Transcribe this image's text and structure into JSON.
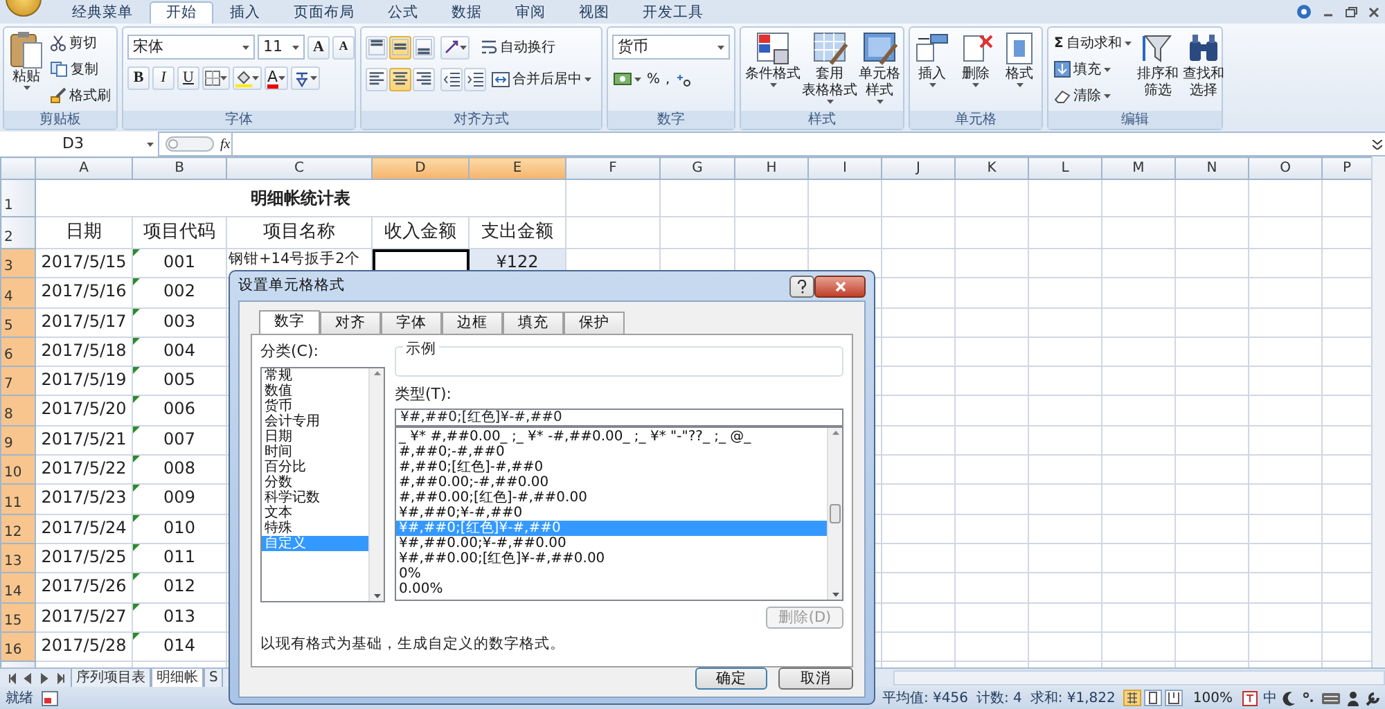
{
  "ribbon_tabs": [
    {
      "label": "经典菜单",
      "selected": false
    },
    {
      "label": "开始",
      "selected": true
    },
    {
      "label": "插入",
      "selected": false
    },
    {
      "label": "页面布局",
      "selected": false
    },
    {
      "label": "公式",
      "selected": false
    },
    {
      "label": "数据",
      "selected": false
    },
    {
      "label": "审阅",
      "selected": false
    },
    {
      "label": "视图",
      "selected": false
    },
    {
      "label": "开发工具",
      "selected": false
    }
  ],
  "clipboard": {
    "title": "剪贴板",
    "paste": "粘贴",
    "cut": "剪切",
    "copy": "复制",
    "format_painter": "格式刷"
  },
  "font": {
    "title": "字体",
    "font_name": "宋体",
    "font_size": "11",
    "grow": "A",
    "shrink": "A",
    "bold": "B",
    "italic": "I",
    "underline": "U",
    "font_color": "A"
  },
  "alignment": {
    "title": "对齐方式",
    "vertical": [
      {
        "kind": "top",
        "on": false
      },
      {
        "kind": "middle",
        "on": true
      },
      {
        "kind": "bottom",
        "on": false
      }
    ],
    "wrap_text": "自动换行",
    "horizontal": [
      {
        "kind": "left",
        "on": false
      },
      {
        "kind": "center",
        "on": true
      },
      {
        "kind": "right",
        "on": false
      }
    ],
    "merge_center": "合并后居中"
  },
  "number": {
    "title": "数字",
    "format": "货币",
    "percent": "%",
    "comma": ","
  },
  "styles": {
    "title": "样式",
    "buttons": [
      {
        "kind": "conditional",
        "lines": [
          "条件格式"
        ]
      },
      {
        "kind": "table",
        "lines": [
          "套用",
          "表格格式"
        ]
      },
      {
        "kind": "cell",
        "lines": [
          "单元格",
          "样式"
        ]
      }
    ]
  },
  "cells": {
    "title": "单元格",
    "buttons": [
      {
        "kind": "insert",
        "label": "插入"
      },
      {
        "kind": "delete",
        "label": "删除"
      },
      {
        "kind": "format",
        "label": "格式"
      }
    ]
  },
  "editing": {
    "title": "编辑",
    "sigma": "Σ",
    "autosum": "自动求和",
    "fill": "填充",
    "clear": "清除",
    "sort": [
      "排序和",
      "筛选"
    ],
    "find": [
      "查找和",
      "选择"
    ]
  },
  "formula_bar": {
    "name_box": "D3",
    "fx": "fx"
  },
  "sheet": {
    "columns": [
      {
        "label": "A",
        "selected": false
      },
      {
        "label": "B",
        "selected": false
      },
      {
        "label": "C",
        "selected": false
      },
      {
        "label": "D",
        "selected": true
      },
      {
        "label": "E",
        "selected": true
      },
      {
        "label": "F",
        "selected": false
      },
      {
        "label": "G",
        "selected": false
      },
      {
        "label": "H",
        "selected": false
      },
      {
        "label": "I",
        "selected": false
      },
      {
        "label": "J",
        "selected": false
      },
      {
        "label": "K",
        "selected": false
      },
      {
        "label": "L",
        "selected": false
      },
      {
        "label": "M",
        "selected": false
      },
      {
        "label": "N",
        "selected": false
      },
      {
        "label": "O",
        "selected": false
      },
      {
        "label": "P",
        "selected": false
      }
    ],
    "title_row": "1",
    "header_row": "2",
    "title": "明细帐统计表",
    "headers": [
      "日期",
      "项目代码",
      "项目名称",
      "收入金额",
      "支出金额"
    ],
    "rows": [
      {
        "number": "3",
        "selected": true,
        "active": true,
        "date": "2017/5/15",
        "code": "001",
        "flagged": true,
        "name": "钢钳+14号扳手2个",
        "expense": "¥122"
      },
      {
        "number": "4",
        "selected": true,
        "active": false,
        "date": "2017/5/16",
        "code": "002",
        "flagged": true
      },
      {
        "number": "5",
        "selected": true,
        "active": false,
        "date": "2017/5/17",
        "code": "003",
        "flagged": true
      },
      {
        "number": "6",
        "selected": true,
        "active": false,
        "date": "2017/5/18",
        "code": "004",
        "flagged": true
      },
      {
        "number": "7",
        "selected": true,
        "active": false,
        "date": "2017/5/19",
        "code": "005",
        "flagged": true
      },
      {
        "number": "8",
        "selected": true,
        "active": false,
        "date": "2017/5/20",
        "code": "006",
        "flagged": true
      },
      {
        "number": "9",
        "selected": true,
        "active": false,
        "date": "2017/5/21",
        "code": "007",
        "flagged": true
      },
      {
        "number": "10",
        "selected": true,
        "active": false,
        "date": "2017/5/22",
        "code": "008",
        "flagged": true
      },
      {
        "number": "11",
        "selected": true,
        "active": false,
        "date": "2017/5/23",
        "code": "009",
        "flagged": true
      },
      {
        "number": "12",
        "selected": true,
        "active": false,
        "date": "2017/5/24",
        "code": "010",
        "flagged": true
      },
      {
        "number": "13",
        "selected": true,
        "active": false,
        "date": "2017/5/25",
        "code": "011",
        "flagged": true
      },
      {
        "number": "14",
        "selected": true,
        "active": false,
        "date": "2017/5/26",
        "code": "012",
        "flagged": true
      },
      {
        "number": "15",
        "selected": true,
        "active": false,
        "date": "2017/5/27",
        "code": "013",
        "flagged": true
      },
      {
        "number": "16",
        "selected": true,
        "active": false,
        "date": "2017/5/28",
        "code": "014",
        "flagged": true
      }
    ]
  },
  "sheet_tabs": [
    {
      "label": "序列项目表",
      "selected": false
    },
    {
      "label": "明细帐",
      "selected": true
    },
    {
      "label": "S",
      "selected": false
    }
  ],
  "status_bar": {
    "ready": "就绪",
    "average": "平均值: ¥456",
    "count": "计数: 4",
    "sum": "求和: ¥1,822",
    "views": [
      {
        "kind": "normal",
        "selected": true
      },
      {
        "kind": "page_layout",
        "selected": false
      },
      {
        "kind": "page_break",
        "selected": false
      }
    ],
    "zoom": "100%",
    "ime": "中"
  },
  "dialog": {
    "title": "设置单元格格式",
    "tabs": [
      {
        "label": "数字",
        "selected": true
      },
      {
        "label": "对齐",
        "selected": false
      },
      {
        "label": "字体",
        "selected": false
      },
      {
        "label": "边框",
        "selected": false
      },
      {
        "label": "填充",
        "selected": false
      },
      {
        "label": "保护",
        "selected": false
      }
    ],
    "category_label": "分类(C):",
    "categories": [
      {
        "label": "常规",
        "selected": false
      },
      {
        "label": "数值",
        "selected": false
      },
      {
        "label": "货币",
        "selected": false
      },
      {
        "label": "会计专用",
        "selected": false
      },
      {
        "label": "日期",
        "selected": false
      },
      {
        "label": "时间",
        "selected": false
      },
      {
        "label": "百分比",
        "selected": false
      },
      {
        "label": "分数",
        "selected": false
      },
      {
        "label": "科学记数",
        "selected": false
      },
      {
        "label": "文本",
        "selected": false
      },
      {
        "label": "特殊",
        "selected": false
      },
      {
        "label": "自定义",
        "selected": true
      }
    ],
    "sample_label": "示例",
    "type_label": "类型(T):",
    "type_value": "¥#,##0;[红色]¥-#,##0",
    "formats": [
      {
        "label": "_ ¥* #,##0.00_ ;_ ¥* -#,##0.00_ ;_ ¥* \"-\"??_ ;_ @_",
        "selected": false
      },
      {
        "label": "#,##0;-#,##0",
        "selected": false
      },
      {
        "label": "#,##0;[红色]-#,##0",
        "selected": false
      },
      {
        "label": "#,##0.00;-#,##0.00",
        "selected": false
      },
      {
        "label": "#,##0.00;[红色]-#,##0.00",
        "selected": false
      },
      {
        "label": "¥#,##0;¥-#,##0",
        "selected": false
      },
      {
        "label": "¥#,##0;[红色]¥-#,##0",
        "selected": true
      },
      {
        "label": "¥#,##0.00;¥-#,##0.00",
        "selected": false
      },
      {
        "label": "¥#,##0.00;[红色]¥-#,##0.00",
        "selected": false
      },
      {
        "label": "0%",
        "selected": false
      },
      {
        "label": "0.00%",
        "selected": false
      }
    ],
    "delete": {
      "label": "删除(D)",
      "disabled": true
    },
    "description": "以现有格式为基础，生成自定义的数字格式。",
    "ok": "确定",
    "cancel": "取消"
  }
}
